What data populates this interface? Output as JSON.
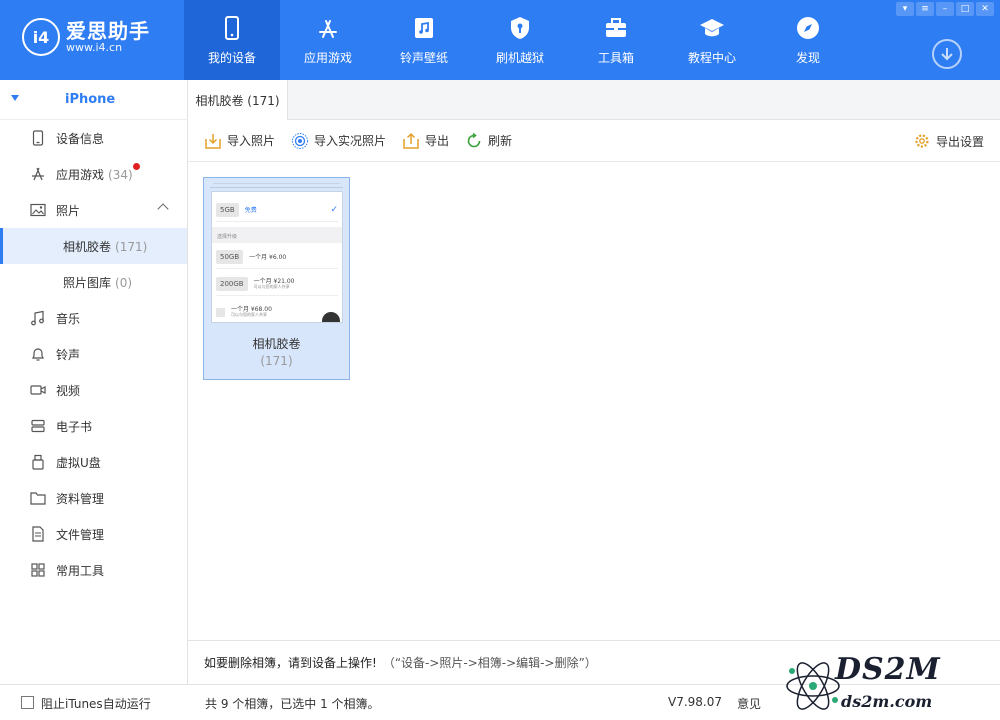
{
  "app": {
    "name": "爱思助手",
    "url": "www.i4.cn",
    "logo_mark": "i4"
  },
  "nav": [
    {
      "label": "我的设备",
      "icon": "phone-icon",
      "active": true
    },
    {
      "label": "应用游戏",
      "icon": "app-store-icon"
    },
    {
      "label": "铃声壁纸",
      "icon": "music-file-icon"
    },
    {
      "label": "刷机越狱",
      "icon": "shield-icon"
    },
    {
      "label": "工具箱",
      "icon": "toolbox-icon"
    },
    {
      "label": "教程中心",
      "icon": "graduation-cap-icon"
    },
    {
      "label": "发现",
      "icon": "compass-icon"
    }
  ],
  "device": {
    "name": "iPhone"
  },
  "sidebar": {
    "items": [
      {
        "label": "设备信息",
        "icon": "device-info-icon"
      },
      {
        "label": "应用游戏",
        "count": "(34)",
        "icon": "app-store-icon",
        "badge": true
      },
      {
        "label": "照片",
        "icon": "photo-icon",
        "expanded": true
      },
      {
        "label": "相机胶卷",
        "count": "(171)",
        "sub": true,
        "active": true
      },
      {
        "label": "照片图库",
        "count": "(0)",
        "sub": true
      },
      {
        "label": "音乐",
        "icon": "music-note-icon"
      },
      {
        "label": "铃声",
        "icon": "bell-icon"
      },
      {
        "label": "视频",
        "icon": "video-icon"
      },
      {
        "label": "电子书",
        "icon": "ebook-icon"
      },
      {
        "label": "虚拟U盘",
        "icon": "usb-drive-icon"
      },
      {
        "label": "资料管理",
        "icon": "folder-icon"
      },
      {
        "label": "文件管理",
        "icon": "file-icon"
      },
      {
        "label": "常用工具",
        "icon": "grid-icon"
      }
    ]
  },
  "tab": {
    "label": "相机胶卷 (171)"
  },
  "toolbar": {
    "import_photos": "导入照片",
    "import_live": "导入实况照片",
    "export": "导出",
    "refresh": "刷新",
    "export_settings": "导出设置"
  },
  "album": {
    "title": "相机胶卷",
    "count": "(171)",
    "thumb": {
      "row1_pill": "5GB",
      "row1_text": "免费",
      "section": "选择升级",
      "row2_pill": "50GB",
      "row2_text": "一个月 ¥6.00",
      "row3_pill": "200GB",
      "row3_text": "一个月 ¥21.00",
      "row3_sub": "可以与您的家人共享",
      "row4_text": "一个月 ¥68.00",
      "row4_sub": "可以与您的家人共享"
    }
  },
  "notice": {
    "main": "如要删除相簿，请到设备上操作!",
    "path": "（“设备->照片->相簿->编辑->删除”）"
  },
  "status": {
    "itunes_label": "阻止iTunes自动运行",
    "selection": "共 9 个相簿，已选中 1 个相簿。",
    "version": "V7.98.07",
    "feedback": "意见"
  },
  "watermark": {
    "text": "DS2M",
    "sub": "ds2m.com"
  },
  "colors": {
    "brand": "#2f7df3",
    "nav_active": "#1f67d9",
    "selection": "#d7e6fb",
    "badge": "#e02020"
  }
}
